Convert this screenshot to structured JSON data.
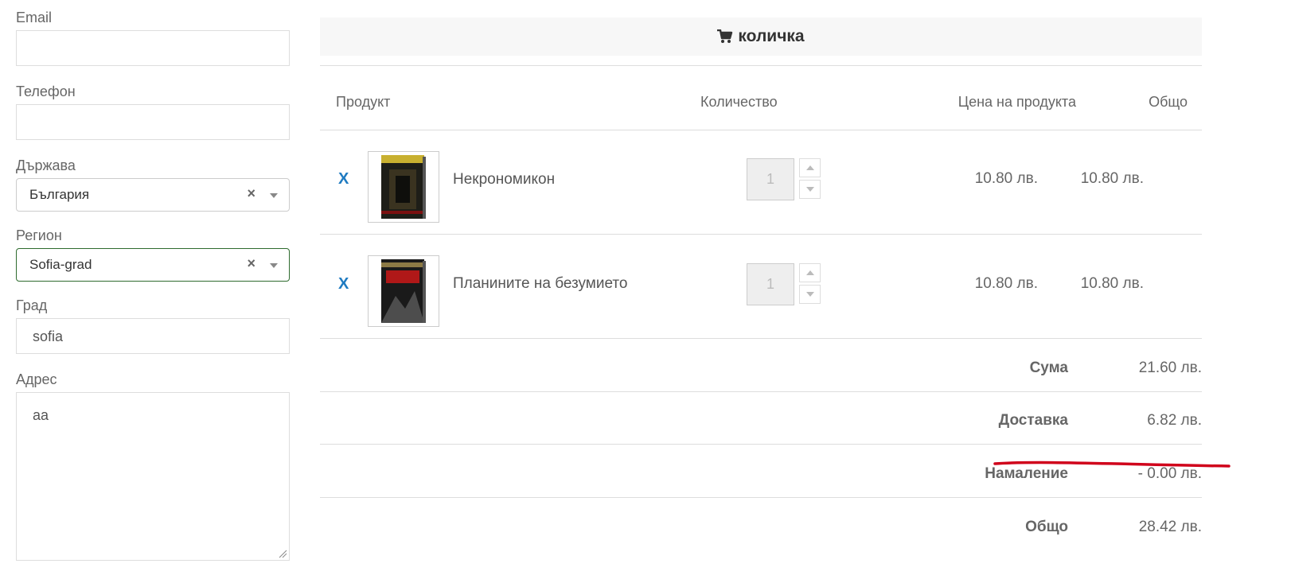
{
  "form": {
    "email_label": "Email",
    "email_value": "",
    "phone_label": "Телефон",
    "phone_value": "",
    "country_label": "Държава",
    "country_value": "България",
    "region_label": "Регион",
    "region_value": "Sofia-grad",
    "city_label": "Град",
    "city_value": "sofia",
    "address_label": "Адрес",
    "address_value": "aa",
    "clear_glyph": "×"
  },
  "cart": {
    "title": "количка",
    "icon": "shopping-cart-icon",
    "columns": {
      "product": "Продукт",
      "quantity": "Количество",
      "price": "Цена на продукта",
      "total": "Общо"
    },
    "remove_label": "X",
    "items": [
      {
        "name": "Некрономикон",
        "quantity": "1",
        "price": "10.80 лв.",
        "total": "10.80 лв."
      },
      {
        "name": "Планините на безумието",
        "quantity": "1",
        "price": "10.80 лв.",
        "total": "10.80 лв."
      }
    ],
    "summary": {
      "subtotal_label": "Сума",
      "subtotal_value": "21.60 лв.",
      "shipping_label": "Доставка",
      "shipping_value": "6.82 лв.",
      "discount_label": "Намаление",
      "discount_value": "- 0.00 лв.",
      "grand_total_label": "Общо",
      "grand_total_value": "28.42 лв."
    }
  },
  "colors": {
    "link_blue": "#1f7bc1",
    "annotation_red": "#d0021b",
    "focus_green": "#2e6b2e"
  }
}
